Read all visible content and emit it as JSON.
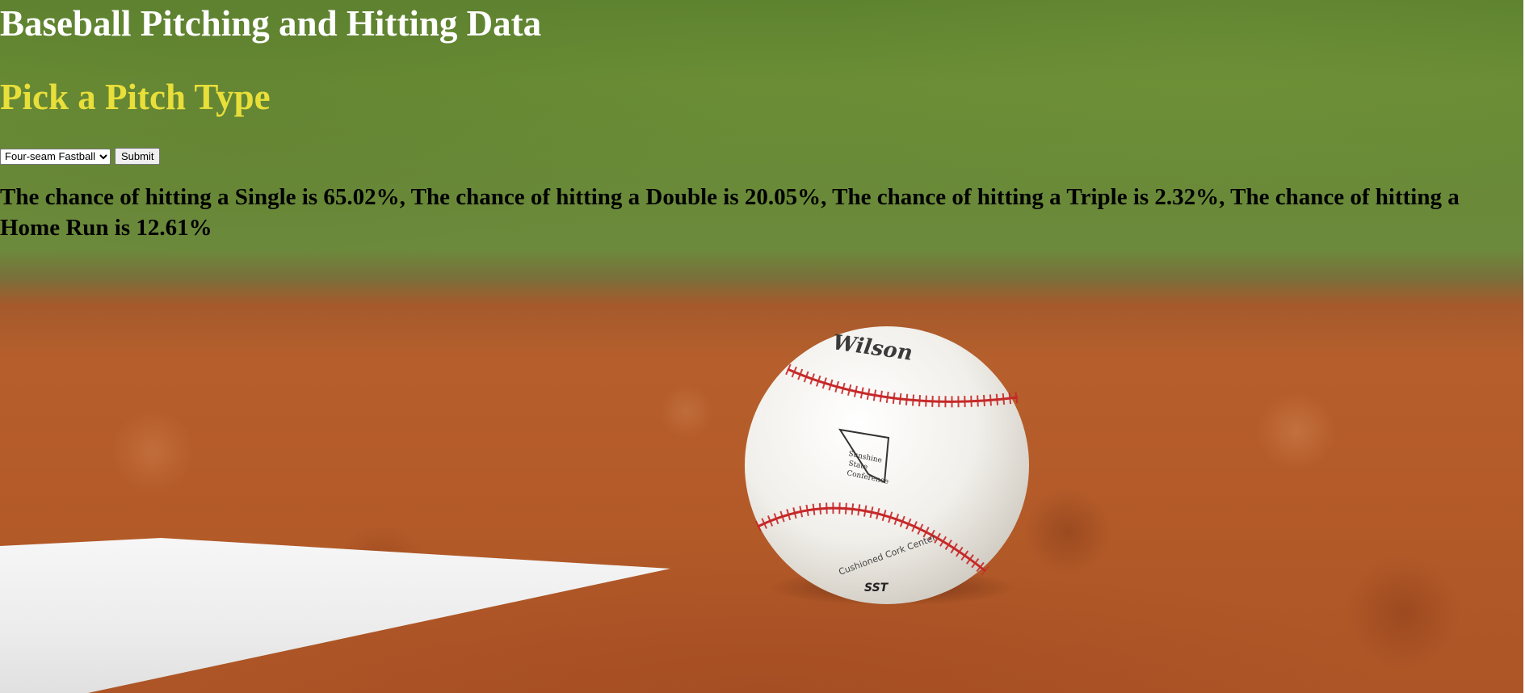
{
  "page": {
    "title": "Baseball Pitching and Hitting Data",
    "subtitle": "Pick a Pitch Type",
    "subtitle_color": "#e9df3a"
  },
  "form": {
    "pitch_select": {
      "selected": "Four-seam Fastball",
      "options": [
        "Four-seam Fastball"
      ]
    },
    "submit_label": "Submit"
  },
  "result": {
    "text": "The chance of hitting a Single is 65.02%, The chance of hitting a Double is 20.05%, The chance of hitting a Triple is 2.32%, The chance of hitting a Home Run is 12.61%",
    "single": "65.02%",
    "double": "20.05%",
    "triple": "2.32%",
    "home_run": "12.61%"
  },
  "background": {
    "ball_logo_text": "Wilson",
    "ball_stamp_text": "SST",
    "ball_seal_text": "Sunshine State Conference",
    "ball_lower_text": "Cushioned Cork Center"
  }
}
